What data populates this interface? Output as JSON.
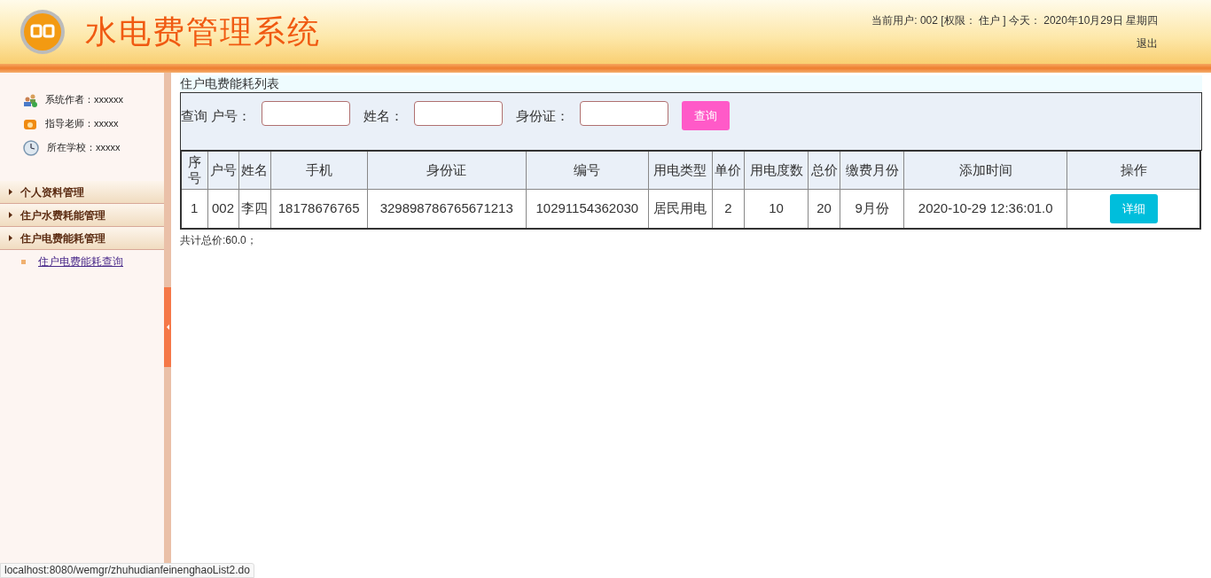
{
  "header": {
    "title": "水电费管理系统",
    "user_info": "当前用户: 002 [权限： 住户 ] 今天： 2020年10月29日 星期四",
    "logout": "退出"
  },
  "sidebar": {
    "info": [
      {
        "kind": "author",
        "text": "系统作者：xxxxxx"
      },
      {
        "kind": "teacher",
        "text": "指导老师：xxxxx"
      },
      {
        "kind": "school",
        "text": "所在学校：xxxxx"
      }
    ],
    "menu": [
      {
        "label": "个人资料管理"
      },
      {
        "label": "住户水费耗能管理"
      },
      {
        "label": "住户电费能耗管理",
        "children": [
          {
            "label": "住户电费能耗查询"
          }
        ]
      }
    ]
  },
  "content": {
    "title": "住户电费能耗列表",
    "search": {
      "prefix": "查询",
      "fields": [
        {
          "label": "户号："
        },
        {
          "label": "姓名："
        },
        {
          "label": "身份证："
        }
      ],
      "button": "查询"
    },
    "table": {
      "columns": [
        "序号",
        "户号",
        "姓名",
        "手机",
        "身份证",
        "编号",
        "用电类型",
        "单价",
        "用电度数",
        "总价",
        "缴费月份",
        "添加时间",
        "操作"
      ],
      "rows": [
        {
          "cells": [
            "1",
            "002",
            "李四",
            "18178676765",
            "329898786765671213",
            "10291154362030",
            "居民用电",
            "2",
            "10",
            "20",
            "9月份",
            "2020-10-29 12:36:01.0"
          ],
          "action": "详细"
        }
      ]
    },
    "total": "共计总价:60.0；"
  },
  "status_url": "localhost:8080/wemgr/zhuhudianfeinenghaoList2.do"
}
